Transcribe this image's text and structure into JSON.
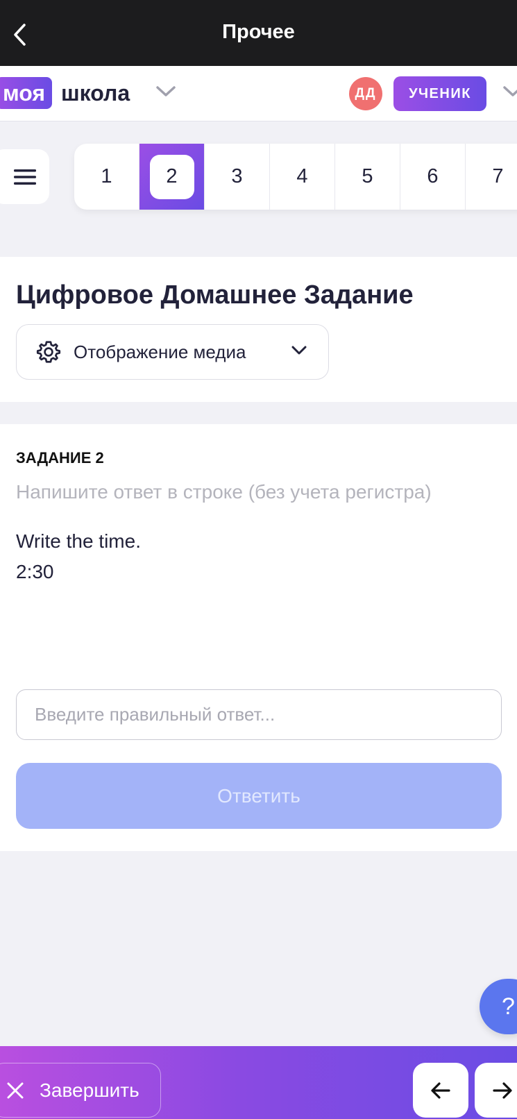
{
  "header": {
    "title": "Прочее"
  },
  "brand": {
    "logo_part1": "моя",
    "logo_part2": "школа",
    "avatar_initials": "ДД",
    "role": "УЧЕНИК"
  },
  "tasks": [
    {
      "label": "1",
      "active": false
    },
    {
      "label": "2",
      "active": true
    },
    {
      "label": "3",
      "active": false
    },
    {
      "label": "4",
      "active": false
    },
    {
      "label": "5",
      "active": false
    },
    {
      "label": "6",
      "active": false
    },
    {
      "label": "7",
      "active": false
    }
  ],
  "homework": {
    "title": "Цифровое Домашнее Задание",
    "media_button": "Отображение медиа"
  },
  "task": {
    "label": "ЗАДАНИЕ 2",
    "hint": "Напишите ответ в строке (без учета регистра)",
    "question_line1": "Write the time.",
    "question_line2": "2:30",
    "answer_placeholder": "Введите правильный ответ...",
    "answer_value": "",
    "submit_label": "Ответить"
  },
  "help": {
    "label": "?"
  },
  "footer": {
    "finish_label": "Завершить"
  },
  "colors": {
    "accent_start": "#9b4ee5",
    "accent_end": "#6a4ce4",
    "avatar": "#f07070",
    "submit_disabled": "#a3b3f8",
    "help": "#5b76ee"
  },
  "icons": {
    "back": "chevron-left-icon",
    "menu": "hamburger-icon",
    "settings": "gear-icon",
    "dropdown": "chevron-down-icon",
    "close": "close-icon",
    "prev": "arrow-left-icon",
    "next": "arrow-right-icon"
  }
}
